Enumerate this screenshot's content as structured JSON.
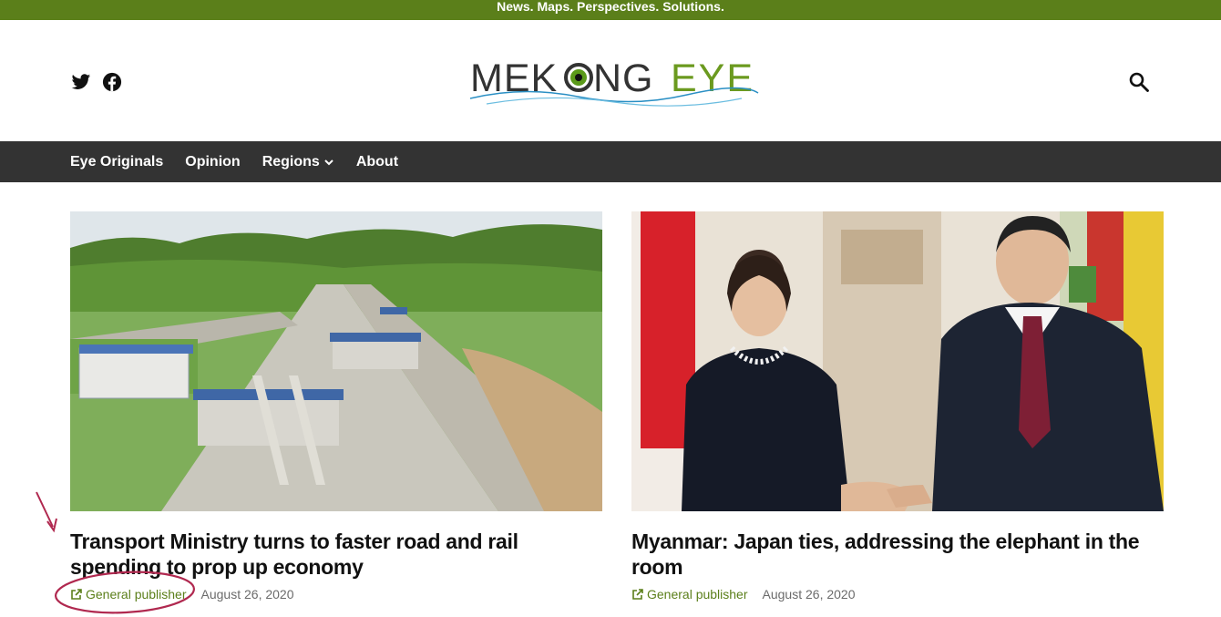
{
  "topbar": {
    "tagline": "News. Maps. Perspectives. Solutions."
  },
  "header": {
    "social": [
      "twitter-icon",
      "facebook-icon"
    ],
    "logo": {
      "part1": "MEK",
      "part2": "NG",
      "part3": "EYE"
    },
    "search_icon": "search-icon"
  },
  "nav": {
    "items": [
      {
        "label": "Eye Originals"
      },
      {
        "label": "Opinion"
      },
      {
        "label": "Regions"
      },
      {
        "label": "About"
      }
    ]
  },
  "articles": [
    {
      "title": "Transport Ministry turns to faster road and rail spending to prop up economy",
      "publisher": "General publisher",
      "date": "August 26, 2020"
    },
    {
      "title": "Myanmar: Japan ties, addressing the elephant in the room",
      "publisher": "General publisher",
      "date": "August 26, 2020"
    }
  ],
  "colors": {
    "brand_green": "#5b7f1a",
    "nav_bg": "#333333",
    "annotation": "#b0284f"
  }
}
